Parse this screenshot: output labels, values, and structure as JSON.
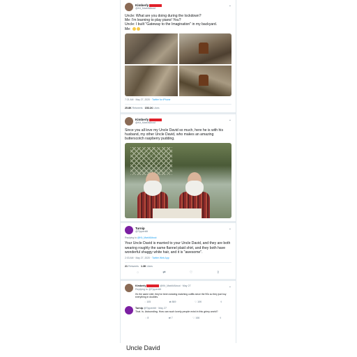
{
  "tweet1": {
    "name": "Kimberly",
    "handle": "@Kit_MarkItAbout",
    "lines": [
      "Uncle: What are you doing during the lockdown?",
      "Me: I'm learning to play piano! You?",
      "Uncle: I built \"Gateway to the Imagination\" in my backyard.",
      "Me:"
    ],
    "time": "7:21 AM · May 27, 2020 ·",
    "source": "Twitter for iPhone",
    "retweets": "25.8K",
    "retweets_label": "Retweets",
    "likes": "153.1K",
    "likes_label": "Likes"
  },
  "tweet2": {
    "name": "Kimberly",
    "handle": "@Kit_MarkItAbout",
    "text": "Since you all love my Uncle David so much, here he is with his husband, my other Uncle David, who makes an amazing butterscotch raspberry pudding."
  },
  "tweet3": {
    "name": "Turnip",
    "handle": "@Tippentilt",
    "reply_prefix": "Replying to",
    "reply_handle": "@Kit_MarkItAbout",
    "text": "Your Uncle David is married to your Uncle David, and they are both wearing roughly the same flannel plaid shirt, and they both have wonderful shaggy white hair, and it is \"awesome\".",
    "time": "2:03 AM · May 27, 2020 ·",
    "source": "Twitter Web App",
    "retweets": "21",
    "retweets_label": "Retweets",
    "likes": "1.3K",
    "likes_label": "Likes"
  },
  "reply1": {
    "name": "Kimberly",
    "handle": "@Kit_MarkItAbout · May 27",
    "reply_to": "Replying to @Tippentilt",
    "text": "It's the same shirt, they've been wearing matching outfits since the 90s so they just buy everything in doubles.",
    "comments": "105",
    "retweets": "869",
    "likes": "10K"
  },
  "reply2": {
    "name": "Turnip",
    "handle": "@Tippentilt · May 27",
    "text": "That. Is. Astounding. How can such lovely people exist in this grimy world?",
    "comments": "8",
    "retweets": "7",
    "likes": "166"
  },
  "caption": "Uncle David"
}
